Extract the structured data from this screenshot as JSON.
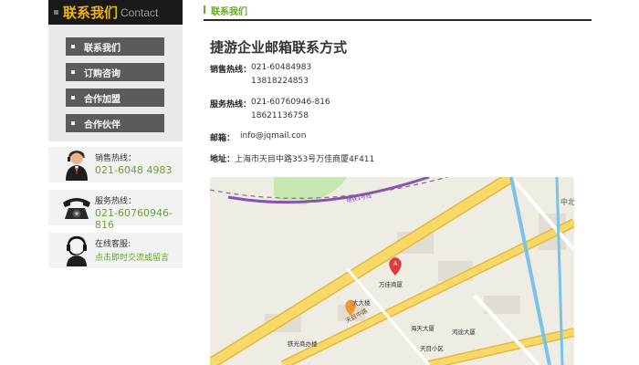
{
  "sidebar": {
    "title_cn": "联系我们",
    "title_en": "Contact",
    "menu": [
      {
        "label": "联系我们"
      },
      {
        "label": "订购咨询"
      },
      {
        "label": "合作加盟"
      },
      {
        "label": "合作伙伴"
      }
    ],
    "cards": [
      {
        "title": "销售热线：",
        "value": "021-6048 4983",
        "icon": "operator-icon"
      },
      {
        "title": "服务热线：",
        "value": "021-60760946-816",
        "icon": "telephone-icon"
      },
      {
        "title": "在线客服:",
        "value": "点击即时交流或留言",
        "icon": "customer-service-icon"
      }
    ]
  },
  "main": {
    "header": "联系我们",
    "title": "捷游企业邮箱联系方式",
    "sales_label": "销售热线：",
    "sales_lines": [
      "021-60484983",
      "13818224853"
    ],
    "service_label": "服务热线：",
    "service_lines": [
      "021-60760946-816",
      "18621136758"
    ],
    "email_label": "邮箱：",
    "email": "info@jqmail.con",
    "address_label": "地址：",
    "address": "上海市天目中路353号万佳商厦4F411"
  },
  "map": {
    "labels": {
      "wanjia": "万佳商厦",
      "dadalou": "大大楼",
      "haitian": "海天大厦",
      "hengtu": "鸿途大厦",
      "tianmu": "天目中路",
      "tieguang": "铁光商办楼",
      "tianmu_xiaoqu": "天目小区",
      "metro": "地铁1号线",
      "zhongbei": "中北"
    },
    "colors": {
      "road": "#f7d96a",
      "road_edge": "#e6b93c",
      "water": "#79c3e8",
      "metro": "#8b4fb8",
      "park": "#c8e6b0",
      "pin": "#e03b3b",
      "pin_orange": "#f29630"
    }
  }
}
